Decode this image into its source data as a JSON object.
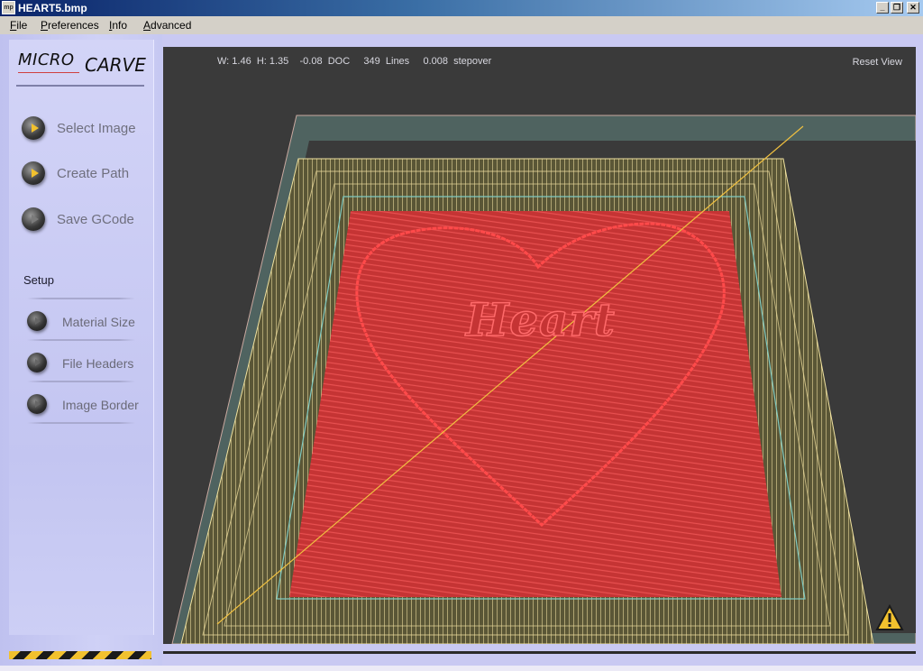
{
  "window": {
    "title": "HEART5.bmp",
    "icon_label": "mp",
    "buttons": [
      "_",
      "❐",
      "✕"
    ]
  },
  "menu": [
    "File",
    "Preferences",
    "Info",
    "Advanced"
  ],
  "logo": {
    "micro": "MICRO",
    "carve": "CARVE"
  },
  "nav": [
    {
      "label": "Select Image",
      "enabled": true
    },
    {
      "label": "Create Path",
      "enabled": true
    },
    {
      "label": "Save GCode",
      "enabled": false
    }
  ],
  "setup": {
    "title": "Setup",
    "items": [
      "Material Size",
      "File Headers",
      "Image Border"
    ]
  },
  "viewport": {
    "info": "W: 1.46  H: 1.35    -0.08  DOC     349  Lines     0.008  stepover",
    "reset_label": "Reset View",
    "carved_text": "Heart"
  },
  "colors": {
    "accent": "#f2c12e",
    "toolpath_red": "#e23b3b",
    "border_yellow": "#e8d89a",
    "viewport_bg": "#3a3a3a"
  },
  "icons": {
    "warning": "warning-icon",
    "play": "play-icon"
  }
}
